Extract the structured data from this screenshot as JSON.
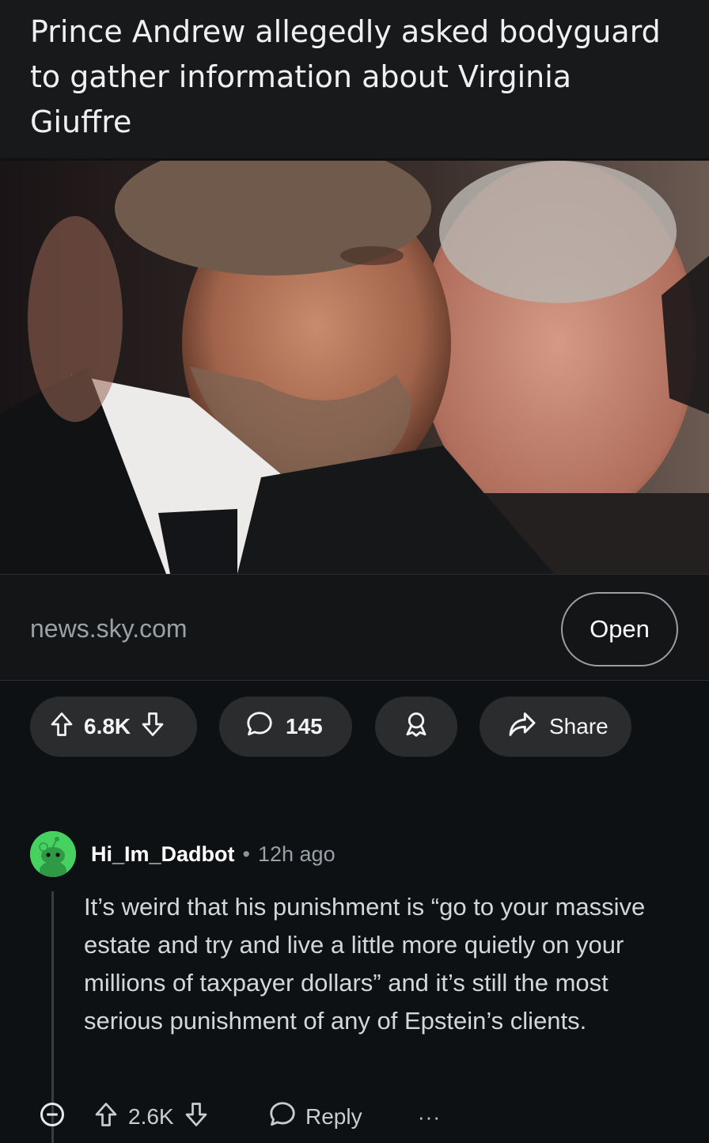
{
  "post": {
    "title": "Prince Andrew allegedly asked bodyguard to gather information about Virginia Giuffre",
    "thumbnail": "photo of two men in dark suits at a formal event",
    "domain": "news.sky.com",
    "open_label": "Open",
    "upvotes": "6.8K",
    "comments": "145",
    "share_label": "Share"
  },
  "comment": {
    "author": "Hi_Im_Dadbot",
    "separator": "•",
    "time": "12h ago",
    "body": "It’s weird that his punishment is “go to your massive estate and try and live a little more quietly on your millions of taxpayer dollars” and it’s still the most serious punishment of any of Epstein’s clients.",
    "upvotes": "2.6K",
    "reply_label": "Reply",
    "more_label": "···"
  },
  "colors": {
    "background": "#0e1113",
    "pill": "#2a2c2e",
    "avatar": "#46d160"
  }
}
